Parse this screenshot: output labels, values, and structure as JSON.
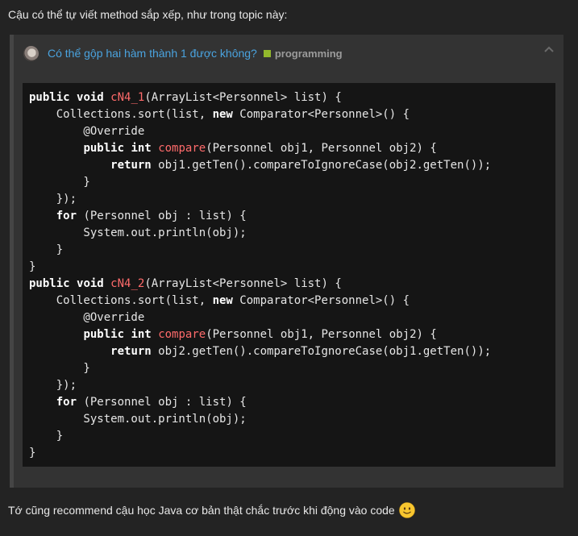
{
  "intro_text": "Cậu có thể tự viết method sắp xếp, như trong topic này:",
  "quote": {
    "topic_title": "Có thể gộp hai hàm thành 1 được không?",
    "category": "programming",
    "category_color": "#92b82c",
    "link_color": "#4aa3df"
  },
  "code_lines": [
    [
      {
        "t": "kw",
        "v": "public"
      },
      {
        "t": "",
        "v": " "
      },
      {
        "t": "kw",
        "v": "void"
      },
      {
        "t": "",
        "v": " "
      },
      {
        "t": "fn",
        "v": "cN4_1"
      },
      {
        "t": "",
        "v": "(ArrayList<Personnel> list) {"
      }
    ],
    [
      {
        "t": "",
        "v": "    Collections.sort(list, "
      },
      {
        "t": "kw",
        "v": "new"
      },
      {
        "t": "",
        "v": " Comparator<Personnel>() {"
      }
    ],
    [
      {
        "t": "",
        "v": "        @Override"
      }
    ],
    [
      {
        "t": "",
        "v": "        "
      },
      {
        "t": "kw",
        "v": "public"
      },
      {
        "t": "",
        "v": " "
      },
      {
        "t": "kw",
        "v": "int"
      },
      {
        "t": "",
        "v": " "
      },
      {
        "t": "fn",
        "v": "compare"
      },
      {
        "t": "",
        "v": "(Personnel obj1, Personnel obj2) {"
      }
    ],
    [
      {
        "t": "",
        "v": "            "
      },
      {
        "t": "kw",
        "v": "return"
      },
      {
        "t": "",
        "v": " obj1.getTen().compareToIgnoreCase(obj2.getTen());"
      }
    ],
    [
      {
        "t": "",
        "v": "        }"
      }
    ],
    [
      {
        "t": "",
        "v": "    });"
      }
    ],
    [
      {
        "t": "",
        "v": "    "
      },
      {
        "t": "kw",
        "v": "for"
      },
      {
        "t": "",
        "v": " (Personnel obj : list) {"
      }
    ],
    [
      {
        "t": "",
        "v": "        System.out.println(obj);"
      }
    ],
    [
      {
        "t": "",
        "v": "    }"
      }
    ],
    [
      {
        "t": "",
        "v": "}"
      }
    ],
    [
      {
        "t": "kw",
        "v": "public"
      },
      {
        "t": "",
        "v": " "
      },
      {
        "t": "kw",
        "v": "void"
      },
      {
        "t": "",
        "v": " "
      },
      {
        "t": "fn",
        "v": "cN4_2"
      },
      {
        "t": "",
        "v": "(ArrayList<Personnel> list) {"
      }
    ],
    [
      {
        "t": "",
        "v": "    Collections.sort(list, "
      },
      {
        "t": "kw",
        "v": "new"
      },
      {
        "t": "",
        "v": " Comparator<Personnel>() {"
      }
    ],
    [
      {
        "t": "",
        "v": "        @Override"
      }
    ],
    [
      {
        "t": "",
        "v": "        "
      },
      {
        "t": "kw",
        "v": "public"
      },
      {
        "t": "",
        "v": " "
      },
      {
        "t": "kw",
        "v": "int"
      },
      {
        "t": "",
        "v": " "
      },
      {
        "t": "fn",
        "v": "compare"
      },
      {
        "t": "",
        "v": "(Personnel obj1, Personnel obj2) {"
      }
    ],
    [
      {
        "t": "",
        "v": "            "
      },
      {
        "t": "kw",
        "v": "return"
      },
      {
        "t": "",
        "v": " obj2.getTen().compareToIgnoreCase(obj1.getTen());"
      }
    ],
    [
      {
        "t": "",
        "v": "        }"
      }
    ],
    [
      {
        "t": "",
        "v": "    });"
      }
    ],
    [
      {
        "t": "",
        "v": "    "
      },
      {
        "t": "kw",
        "v": "for"
      },
      {
        "t": "",
        "v": " (Personnel obj : list) {"
      }
    ],
    [
      {
        "t": "",
        "v": "        System.out.println(obj);"
      }
    ],
    [
      {
        "t": "",
        "v": "    }"
      }
    ],
    [
      {
        "t": "",
        "v": "}"
      }
    ]
  ],
  "outro_text": "Tớ cũng recommend cậu học Java cơ bản thật chắc trước khi động vào code",
  "outro_emoji": "slightly-smiling-face-icon"
}
